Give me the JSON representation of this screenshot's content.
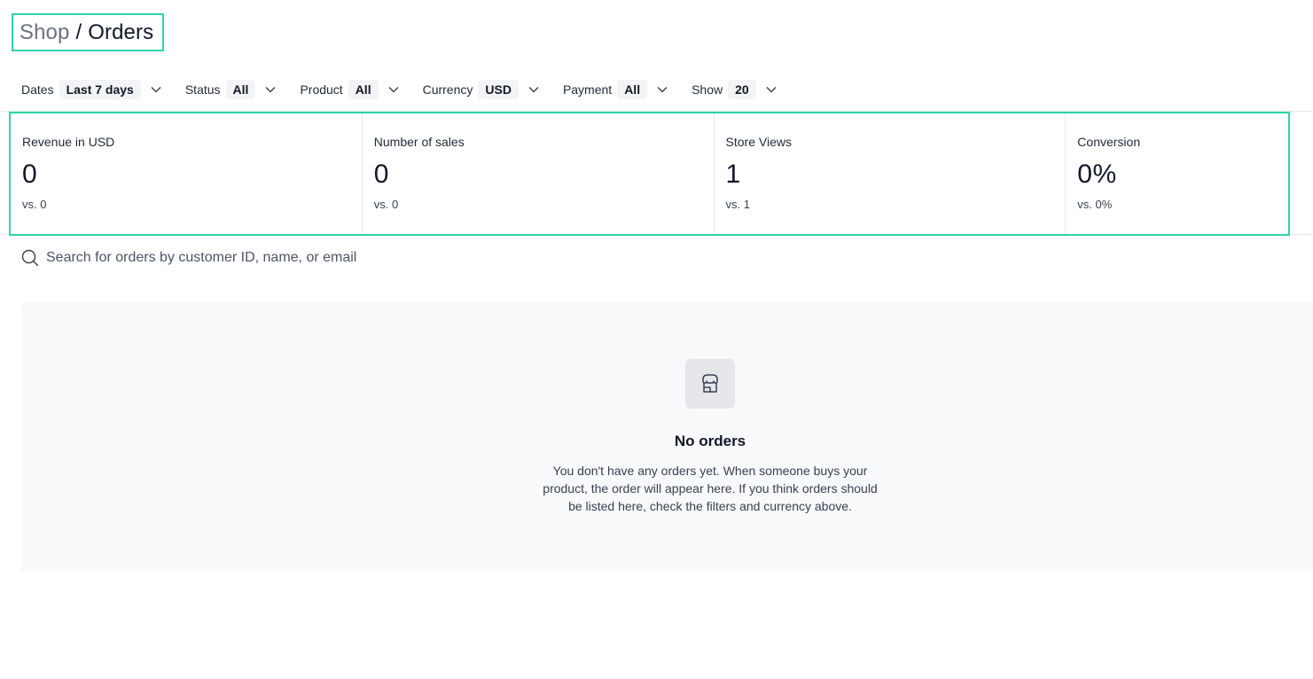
{
  "breadcrumb": {
    "parent": "Shop",
    "separator": "/",
    "current": "Orders"
  },
  "filters": [
    {
      "label": "Dates",
      "value": "Last 7 days"
    },
    {
      "label": "Status",
      "value": "All"
    },
    {
      "label": "Product",
      "value": "All"
    },
    {
      "label": "Currency",
      "value": "USD"
    },
    {
      "label": "Payment",
      "value": "All"
    },
    {
      "label": "Show",
      "value": "20"
    }
  ],
  "stats": [
    {
      "label": "Revenue in USD",
      "value": "0",
      "compare": "vs. 0"
    },
    {
      "label": "Number of sales",
      "value": "0",
      "compare": "vs. 0"
    },
    {
      "label": "Store Views",
      "value": "1",
      "compare": "vs. 1"
    },
    {
      "label": "Conversion",
      "value": "0%",
      "compare": "vs. 0%"
    }
  ],
  "search": {
    "placeholder": "Search for orders by customer ID, name, or email",
    "value": "",
    "icon": "search-icon"
  },
  "empty_state": {
    "icon": "store-icon",
    "title": "No orders",
    "description": "You don't have any orders yet. When someone buys your product, the order will appear here. If you think orders should be listed here, check the filters and currency above."
  },
  "colors": {
    "highlight": "#2dd4a7",
    "chip_bg": "#f3f4f6",
    "empty_bg": "#f8f9fa"
  }
}
